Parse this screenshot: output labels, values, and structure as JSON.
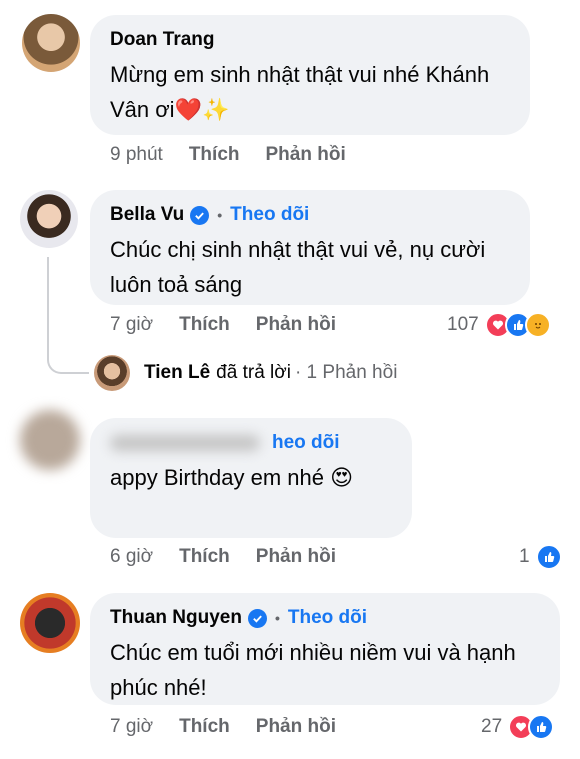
{
  "comments": [
    {
      "name": "Doan Trang",
      "verified": false,
      "text": "Mừng em sinh nhật thật vui nhé Khánh Vân ơi❤️✨",
      "time": "9 phút",
      "like": "Thích",
      "reply": "Phản hồi"
    },
    {
      "name": "Bella Vu",
      "verified": true,
      "follow": "Theo dõi",
      "text": "Chúc chị sinh nhật thật vui vẻ, nụ cười luôn toả sáng",
      "time": "7 giờ",
      "like": "Thích",
      "reply": "Phản hồi",
      "reaction_count": "107",
      "reactions": [
        "love",
        "like",
        "care"
      ]
    },
    {
      "name": "",
      "verified": false,
      "follow": "Theo dõi",
      "follow_visible": "heo dõi",
      "text": "appy Birthday em nhé 😍",
      "time": "6 giờ",
      "like": "Thích",
      "reply": "Phản hồi",
      "reaction_count": "1",
      "reactions": [
        "like"
      ]
    },
    {
      "name": "Thuan Nguyen",
      "verified": true,
      "follow": "Theo dõi",
      "text": "Chúc em tuổi mới nhiều niềm vui và hạnh phúc nhé!",
      "time": "7 giờ",
      "like": "Thích",
      "reply": "Phản hồi",
      "reaction_count": "27",
      "reactions": [
        "love",
        "like"
      ]
    }
  ],
  "reply_summary": {
    "name": "Tien Lê",
    "text": "đã trả lời",
    "count": "· 1 Phản hồi"
  },
  "colors": {
    "accent": "#1877f2",
    "love": "#f33e58",
    "care": "#f7b125",
    "bubble": "#f0f2f5",
    "meta": "#65676b"
  }
}
